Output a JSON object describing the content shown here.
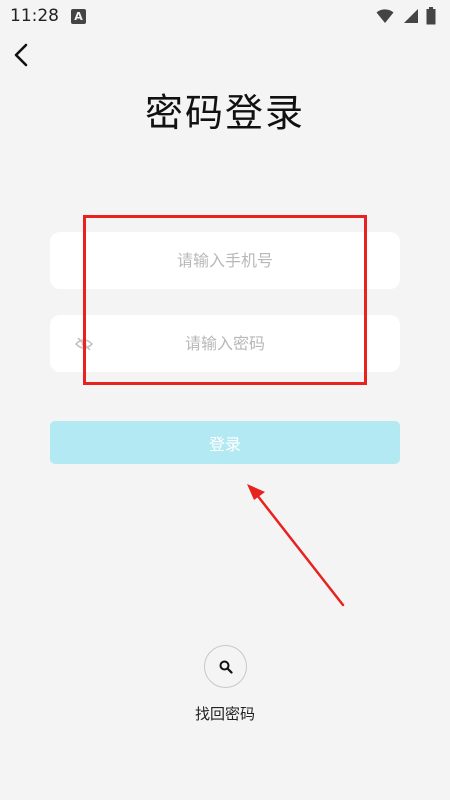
{
  "status_bar": {
    "time": "11:28",
    "badge_letter": "A"
  },
  "page": {
    "title": "密码登录"
  },
  "form": {
    "phone_placeholder": "请输入手机号",
    "password_placeholder": "请输入密码",
    "login_label": "登录",
    "login_color": "#b3e9f3"
  },
  "recovery": {
    "label": "找回密码"
  },
  "annotation": {
    "highlight_color": "#e8231f"
  },
  "icons": [
    "back-arrow-icon",
    "wifi-icon",
    "signal-icon",
    "battery-icon",
    "eye-off-icon",
    "search-icon"
  ]
}
